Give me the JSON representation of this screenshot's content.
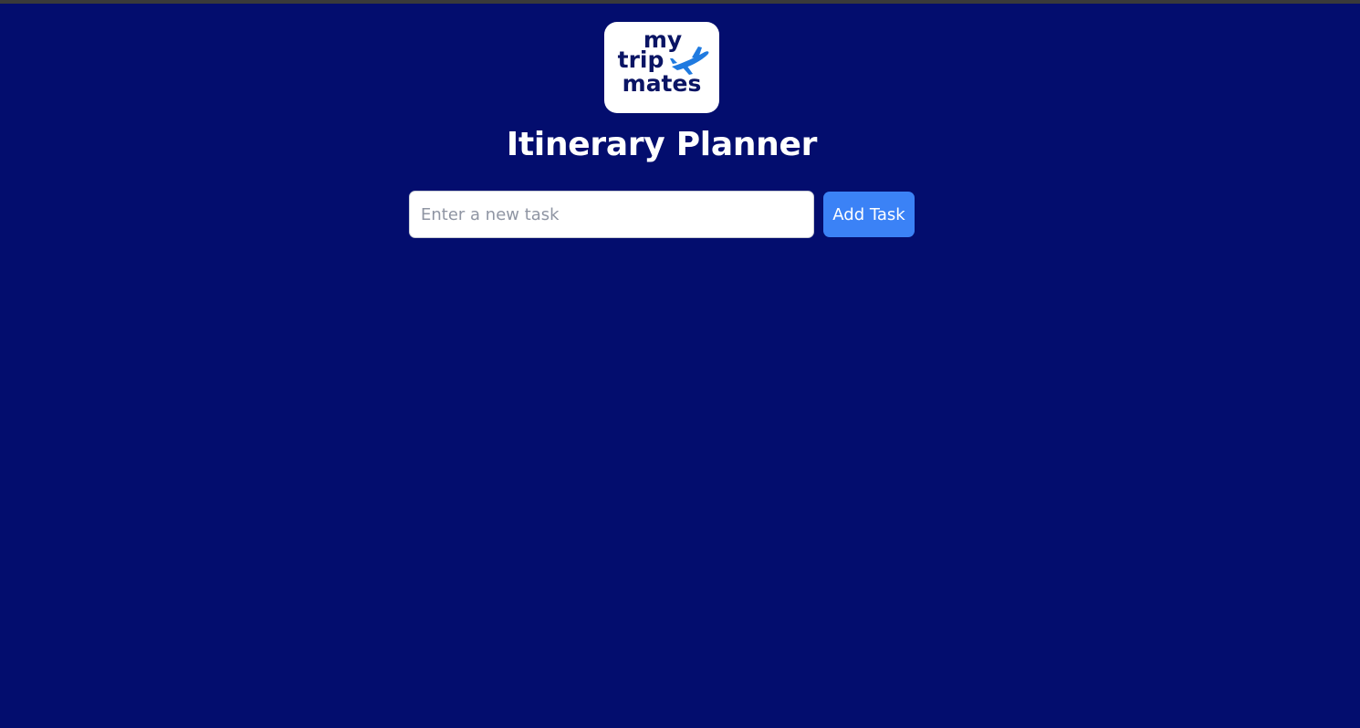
{
  "brand": {
    "logo_lines": [
      "my",
      "trip",
      "mates"
    ],
    "logo_icon": "airplane-icon",
    "logo_text_color": "#0a1464",
    "logo_icon_color": "#1f7ae0"
  },
  "header": {
    "title": "Itinerary Planner"
  },
  "task_form": {
    "placeholder": "Enter a new task",
    "value": "",
    "add_label": "Add Task"
  },
  "tasks": [],
  "colors": {
    "background": "#030d6e",
    "accent": "#3b82f6",
    "card": "#ffffff"
  }
}
